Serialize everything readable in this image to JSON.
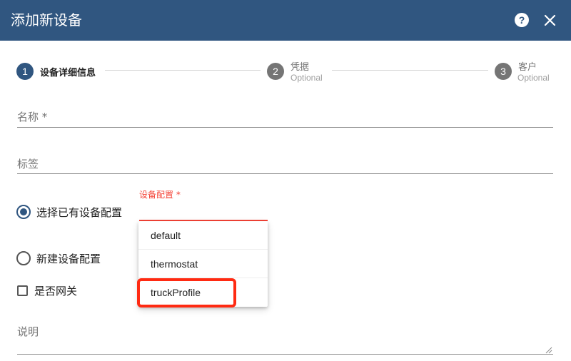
{
  "dialog": {
    "title": "添加新设备",
    "help_label": "?"
  },
  "stepper": {
    "steps": [
      {
        "number": "1",
        "label": "设备详细信息",
        "sub": ""
      },
      {
        "number": "2",
        "label": "凭据",
        "sub": "Optional"
      },
      {
        "number": "3",
        "label": "客户",
        "sub": "Optional"
      }
    ]
  },
  "form": {
    "name_label": "名称 *",
    "label_label": "标签",
    "select_existing_profile": "选择已有设备配置",
    "create_new_profile": "新建设备配置",
    "device_profile_label": "设备配置 *",
    "is_gateway": "是否网关",
    "description_label": "说明"
  },
  "dropdown": {
    "options": [
      "default",
      "thermostat",
      "truckProfile"
    ],
    "highlighted_option": "truckProfile"
  },
  "colors": {
    "header": "#305680",
    "accent": "#305680",
    "error": "#f44336",
    "highlight": "#ff2a12"
  }
}
